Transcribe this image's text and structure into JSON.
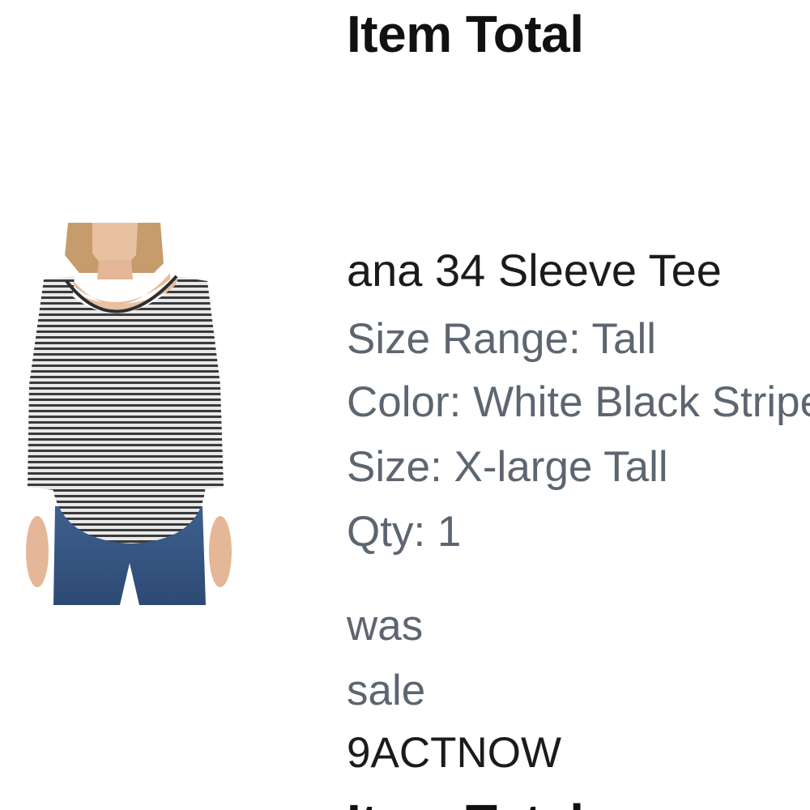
{
  "summary": {
    "heading": "Item Total",
    "heading_repeat": "Item Total"
  },
  "item": {
    "name": "ana 34 Sleeve Tee",
    "size_range": "Size Range: Tall",
    "color": "Color: White Black Stripe",
    "size": "Size: X-large Tall",
    "qty": "Qty: 1",
    "was_label": "was",
    "sale_label": "sale",
    "promo_code": "9ACTNOW"
  },
  "colors": {
    "text_primary": "#1b1b1b",
    "text_secondary": "#5d6670",
    "heading": "#111111"
  },
  "icons": {
    "product": "striped-tee-product-photo"
  }
}
